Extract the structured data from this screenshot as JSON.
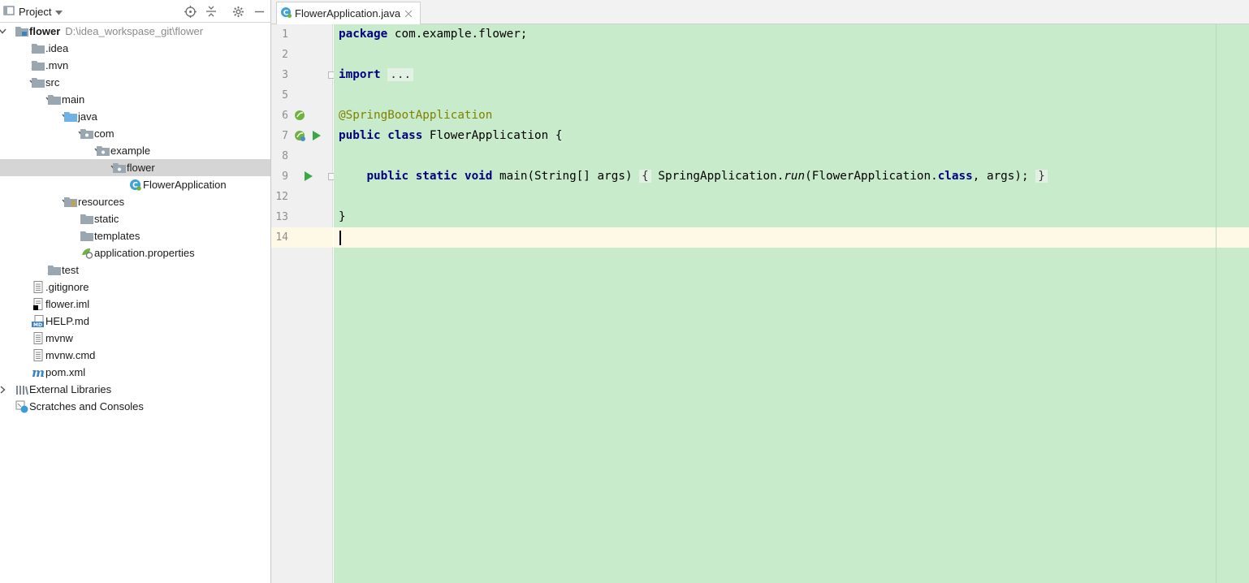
{
  "project_panel": {
    "view_label": "Project",
    "tree": [
      {
        "label": "flower",
        "path": "D:\\idea_workspase_git\\flower",
        "icon": "module-folder-icon",
        "bold": true,
        "expanded": true,
        "depth": 0
      },
      {
        "label": ".idea",
        "icon": "folder-icon",
        "expanded": false,
        "depth": 1
      },
      {
        "label": ".mvn",
        "icon": "folder-icon",
        "expanded": false,
        "depth": 1
      },
      {
        "label": "src",
        "icon": "folder-icon",
        "expanded": true,
        "depth": 1
      },
      {
        "label": "main",
        "icon": "folder-icon",
        "expanded": true,
        "depth": 2
      },
      {
        "label": "java",
        "icon": "source-folder-icon",
        "expanded": true,
        "depth": 3
      },
      {
        "label": "com",
        "icon": "package-icon",
        "expanded": true,
        "depth": 4
      },
      {
        "label": "example",
        "icon": "package-icon",
        "expanded": true,
        "depth": 5
      },
      {
        "label": "flower",
        "icon": "package-icon",
        "expanded": true,
        "depth": 6,
        "selected": true
      },
      {
        "label": "FlowerApplication",
        "icon": "spring-class-icon",
        "depth": 7
      },
      {
        "label": "resources",
        "icon": "resources-folder-icon",
        "expanded": true,
        "depth": 3
      },
      {
        "label": "static",
        "icon": "folder-icon",
        "depth": 4
      },
      {
        "label": "templates",
        "icon": "folder-icon",
        "depth": 4
      },
      {
        "label": "application.properties",
        "icon": "properties-file-icon",
        "depth": 4
      },
      {
        "label": "test",
        "icon": "folder-icon",
        "expanded": false,
        "depth": 2
      },
      {
        "label": ".gitignore",
        "icon": "text-file-icon",
        "depth": 1
      },
      {
        "label": "flower.iml",
        "icon": "iml-file-icon",
        "depth": 1
      },
      {
        "label": "HELP.md",
        "icon": "markdown-file-icon",
        "depth": 1
      },
      {
        "label": "mvnw",
        "icon": "text-file-icon",
        "depth": 1
      },
      {
        "label": "mvnw.cmd",
        "icon": "text-file-icon",
        "depth": 1
      },
      {
        "label": "pom.xml",
        "icon": "maven-file-icon",
        "depth": 1
      },
      {
        "label": "External Libraries",
        "icon": "libraries-icon",
        "expanded": false,
        "depth": 0
      },
      {
        "label": "Scratches and Consoles",
        "icon": "scratches-icon",
        "depth": 0
      }
    ]
  },
  "editor": {
    "tab_label": "FlowerApplication.java",
    "line_numbers": [
      "1",
      "2",
      "3",
      "5",
      "6",
      "7",
      "8",
      "9",
      "12",
      "13",
      "14"
    ],
    "code": {
      "l1_kw": "package",
      "l1_rest": " com.example.flower;",
      "l3_kw": "import",
      "l3_fold": "...",
      "l6_anno": "@SpringBootApplication",
      "l7_kw1": "public",
      "l7_kw2": "class",
      "l7_rest": " FlowerApplication {",
      "l9_kw1": "public",
      "l9_kw2": "static",
      "l9_kw3": "void",
      "l9_mid": " main(String[] args) ",
      "l9_open": "{",
      "l9_call": " SpringApplication.",
      "l9_run": "run",
      "l9_args": "(FlowerApplication.",
      "l9_class": "class",
      "l9_end": ", args);",
      "l9_close": "}",
      "l13": "}"
    }
  },
  "colors": {
    "code_background": "#c8ebcc",
    "current_line": "#fdf9e6",
    "keyword": "#000080",
    "annotation": "#808000",
    "selection": "#d5d5d5"
  }
}
